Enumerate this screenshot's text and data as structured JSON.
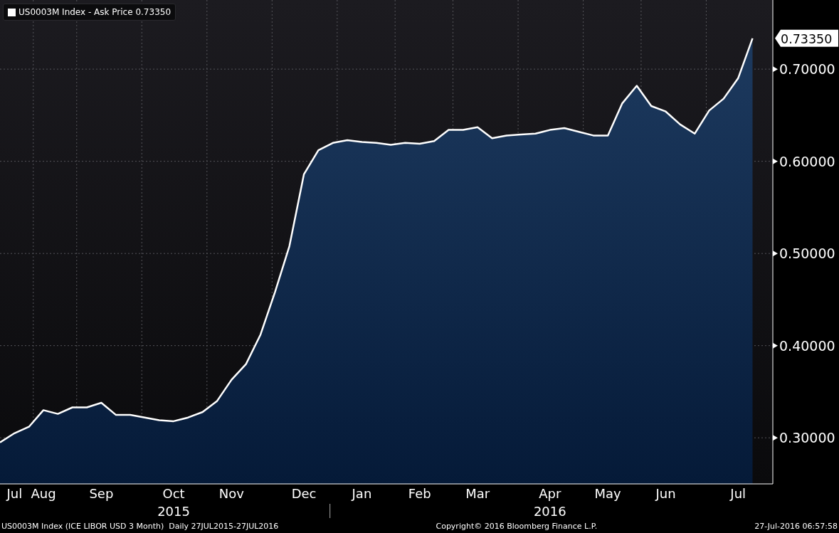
{
  "legend": {
    "value": "0.73350"
  },
  "chart": {
    "last_value_label": "0.73350",
    "year_labels": [
      "2015",
      "2016"
    ],
    "chart_data": {
      "type": "area",
      "grid": true,
      "ylim": [
        0.25,
        0.775
      ],
      "yticks": [
        {
          "value": 0.3,
          "label": "0.30000"
        },
        {
          "value": 0.4,
          "label": "0.40000"
        },
        {
          "value": 0.5,
          "label": "0.50000"
        },
        {
          "value": 0.6,
          "label": "0.60000"
        },
        {
          "value": 0.7,
          "label": "0.70000"
        }
      ],
      "categories": [
        null,
        "Jul",
        null,
        "Aug",
        null,
        null,
        null,
        "Sep",
        null,
        null,
        null,
        null,
        "Oct",
        null,
        null,
        null,
        "Nov",
        null,
        null,
        null,
        null,
        "Dec",
        null,
        null,
        null,
        "Jan",
        null,
        null,
        null,
        "Feb",
        null,
        null,
        null,
        "Mar",
        null,
        null,
        null,
        null,
        "Apr",
        null,
        null,
        null,
        "May",
        null,
        null,
        null,
        "Jun",
        null,
        null,
        null,
        null,
        "Jul",
        null
      ],
      "series": [
        {
          "name": "US0003M Index - Ask Price",
          "color": "#ffffff",
          "values": [
            0.295,
            0.305,
            0.312,
            0.33,
            0.326,
            0.333,
            0.333,
            0.338,
            0.325,
            0.325,
            0.322,
            0.319,
            0.318,
            0.322,
            0.328,
            0.34,
            0.363,
            0.38,
            0.412,
            0.458,
            0.508,
            0.586,
            0.612,
            0.62,
            0.623,
            0.621,
            0.62,
            0.618,
            0.62,
            0.619,
            0.622,
            0.634,
            0.634,
            0.637,
            0.625,
            0.628,
            0.629,
            0.63,
            0.634,
            0.636,
            0.632,
            0.628,
            0.628,
            0.663,
            0.682,
            0.66,
            0.654,
            0.64,
            0.63,
            0.655,
            0.668,
            0.69,
            0.7335
          ]
        }
      ]
    }
  },
  "footer": {
    "left": "US0003M Index (ICE LIBOR USD 3 Month)  Daily 27JUL2015-27JUL2016",
    "center": "Copyright© 2016 Bloomberg Finance L.P.",
    "right": "27-Jul-2016 06:57:58"
  }
}
